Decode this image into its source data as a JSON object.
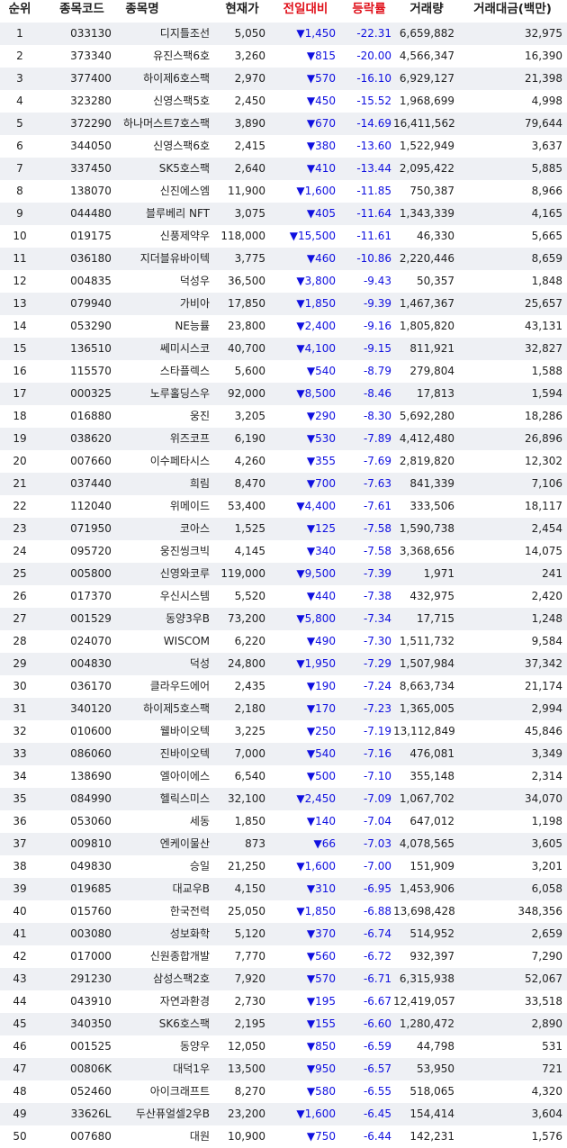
{
  "header": {
    "rank": "순위",
    "code": "종목코드",
    "name": "종목명",
    "price": "현재가",
    "change": "전일대비",
    "rate": "등락률",
    "volume": "거래량",
    "amount": "거래대금(백만)"
  },
  "colors": {
    "down": "#1010e0",
    "header_red": "#e0101a",
    "row_alt": "#eef0f4"
  },
  "rows": [
    {
      "rank": "1",
      "code": "033130",
      "name": "디지틀조선",
      "price": "5,050",
      "change": "▼1,450",
      "rate": "-22.31",
      "volume": "6,659,882",
      "amount": "32,975"
    },
    {
      "rank": "2",
      "code": "373340",
      "name": "유진스팩6호",
      "price": "3,260",
      "change": "▼815",
      "rate": "-20.00",
      "volume": "4,566,347",
      "amount": "16,390"
    },
    {
      "rank": "3",
      "code": "377400",
      "name": "하이제6호스팩",
      "price": "2,970",
      "change": "▼570",
      "rate": "-16.10",
      "volume": "6,929,127",
      "amount": "21,398"
    },
    {
      "rank": "4",
      "code": "323280",
      "name": "신영스팩5호",
      "price": "2,450",
      "change": "▼450",
      "rate": "-15.52",
      "volume": "1,968,699",
      "amount": "4,998"
    },
    {
      "rank": "5",
      "code": "372290",
      "name": "하나머스트7호스팩",
      "price": "3,890",
      "change": "▼670",
      "rate": "-14.69",
      "volume": "16,411,562",
      "amount": "79,644"
    },
    {
      "rank": "6",
      "code": "344050",
      "name": "신영스팩6호",
      "price": "2,415",
      "change": "▼380",
      "rate": "-13.60",
      "volume": "1,522,949",
      "amount": "3,637"
    },
    {
      "rank": "7",
      "code": "337450",
      "name": "SK5호스팩",
      "price": "2,640",
      "change": "▼410",
      "rate": "-13.44",
      "volume": "2,095,422",
      "amount": "5,885"
    },
    {
      "rank": "8",
      "code": "138070",
      "name": "신진에스엠",
      "price": "11,900",
      "change": "▼1,600",
      "rate": "-11.85",
      "volume": "750,387",
      "amount": "8,966"
    },
    {
      "rank": "9",
      "code": "044480",
      "name": "블루베리 NFT",
      "price": "3,075",
      "change": "▼405",
      "rate": "-11.64",
      "volume": "1,343,339",
      "amount": "4,165"
    },
    {
      "rank": "10",
      "code": "019175",
      "name": "신풍제약우",
      "price": "118,000",
      "change": "▼15,500",
      "rate": "-11.61",
      "volume": "46,330",
      "amount": "5,665"
    },
    {
      "rank": "11",
      "code": "036180",
      "name": "지더블유바이텍",
      "price": "3,775",
      "change": "▼460",
      "rate": "-10.86",
      "volume": "2,220,446",
      "amount": "8,659"
    },
    {
      "rank": "12",
      "code": "004835",
      "name": "덕성우",
      "price": "36,500",
      "change": "▼3,800",
      "rate": "-9.43",
      "volume": "50,357",
      "amount": "1,848"
    },
    {
      "rank": "13",
      "code": "079940",
      "name": "가비아",
      "price": "17,850",
      "change": "▼1,850",
      "rate": "-9.39",
      "volume": "1,467,367",
      "amount": "25,657"
    },
    {
      "rank": "14",
      "code": "053290",
      "name": "NE능률",
      "price": "23,800",
      "change": "▼2,400",
      "rate": "-9.16",
      "volume": "1,805,820",
      "amount": "43,131"
    },
    {
      "rank": "15",
      "code": "136510",
      "name": "쎄미시스코",
      "price": "40,700",
      "change": "▼4,100",
      "rate": "-9.15",
      "volume": "811,921",
      "amount": "32,827"
    },
    {
      "rank": "16",
      "code": "115570",
      "name": "스타플렉스",
      "price": "5,600",
      "change": "▼540",
      "rate": "-8.79",
      "volume": "279,804",
      "amount": "1,588"
    },
    {
      "rank": "17",
      "code": "000325",
      "name": "노루홀딩스우",
      "price": "92,000",
      "change": "▼8,500",
      "rate": "-8.46",
      "volume": "17,813",
      "amount": "1,594"
    },
    {
      "rank": "18",
      "code": "016880",
      "name": "웅진",
      "price": "3,205",
      "change": "▼290",
      "rate": "-8.30",
      "volume": "5,692,280",
      "amount": "18,286"
    },
    {
      "rank": "19",
      "code": "038620",
      "name": "위즈코프",
      "price": "6,190",
      "change": "▼530",
      "rate": "-7.89",
      "volume": "4,412,480",
      "amount": "26,896"
    },
    {
      "rank": "20",
      "code": "007660",
      "name": "이수페타시스",
      "price": "4,260",
      "change": "▼355",
      "rate": "-7.69",
      "volume": "2,819,820",
      "amount": "12,302"
    },
    {
      "rank": "21",
      "code": "037440",
      "name": "희림",
      "price": "8,470",
      "change": "▼700",
      "rate": "-7.63",
      "volume": "841,339",
      "amount": "7,106"
    },
    {
      "rank": "22",
      "code": "112040",
      "name": "위메이드",
      "price": "53,400",
      "change": "▼4,400",
      "rate": "-7.61",
      "volume": "333,506",
      "amount": "18,117"
    },
    {
      "rank": "23",
      "code": "071950",
      "name": "코아스",
      "price": "1,525",
      "change": "▼125",
      "rate": "-7.58",
      "volume": "1,590,738",
      "amount": "2,454"
    },
    {
      "rank": "24",
      "code": "095720",
      "name": "웅진씽크빅",
      "price": "4,145",
      "change": "▼340",
      "rate": "-7.58",
      "volume": "3,368,656",
      "amount": "14,075"
    },
    {
      "rank": "25",
      "code": "005800",
      "name": "신영와코루",
      "price": "119,000",
      "change": "▼9,500",
      "rate": "-7.39",
      "volume": "1,971",
      "amount": "241"
    },
    {
      "rank": "26",
      "code": "017370",
      "name": "우신시스템",
      "price": "5,520",
      "change": "▼440",
      "rate": "-7.38",
      "volume": "432,975",
      "amount": "2,420"
    },
    {
      "rank": "27",
      "code": "001529",
      "name": "동양3우B",
      "price": "73,200",
      "change": "▼5,800",
      "rate": "-7.34",
      "volume": "17,715",
      "amount": "1,248"
    },
    {
      "rank": "28",
      "code": "024070",
      "name": "WISCOM",
      "price": "6,220",
      "change": "▼490",
      "rate": "-7.30",
      "volume": "1,511,732",
      "amount": "9,584"
    },
    {
      "rank": "29",
      "code": "004830",
      "name": "덕성",
      "price": "24,800",
      "change": "▼1,950",
      "rate": "-7.29",
      "volume": "1,507,984",
      "amount": "37,342"
    },
    {
      "rank": "30",
      "code": "036170",
      "name": "클라우드에어",
      "price": "2,435",
      "change": "▼190",
      "rate": "-7.24",
      "volume": "8,663,734",
      "amount": "21,174"
    },
    {
      "rank": "31",
      "code": "340120",
      "name": "하이제5호스팩",
      "price": "2,180",
      "change": "▼170",
      "rate": "-7.23",
      "volume": "1,365,005",
      "amount": "2,994"
    },
    {
      "rank": "32",
      "code": "010600",
      "name": "웰바이오텍",
      "price": "3,225",
      "change": "▼250",
      "rate": "-7.19",
      "volume": "13,112,849",
      "amount": "45,846"
    },
    {
      "rank": "33",
      "code": "086060",
      "name": "진바이오텍",
      "price": "7,000",
      "change": "▼540",
      "rate": "-7.16",
      "volume": "476,081",
      "amount": "3,349"
    },
    {
      "rank": "34",
      "code": "138690",
      "name": "엘아이에스",
      "price": "6,540",
      "change": "▼500",
      "rate": "-7.10",
      "volume": "355,148",
      "amount": "2,314"
    },
    {
      "rank": "35",
      "code": "084990",
      "name": "헬릭스미스",
      "price": "32,100",
      "change": "▼2,450",
      "rate": "-7.09",
      "volume": "1,067,702",
      "amount": "34,070"
    },
    {
      "rank": "36",
      "code": "053060",
      "name": "세동",
      "price": "1,850",
      "change": "▼140",
      "rate": "-7.04",
      "volume": "647,012",
      "amount": "1,198"
    },
    {
      "rank": "37",
      "code": "009810",
      "name": "엔케이물산",
      "price": "873",
      "change": "▼66",
      "rate": "-7.03",
      "volume": "4,078,565",
      "amount": "3,605"
    },
    {
      "rank": "38",
      "code": "049830",
      "name": "승일",
      "price": "21,250",
      "change": "▼1,600",
      "rate": "-7.00",
      "volume": "151,909",
      "amount": "3,201"
    },
    {
      "rank": "39",
      "code": "019685",
      "name": "대교우B",
      "price": "4,150",
      "change": "▼310",
      "rate": "-6.95",
      "volume": "1,453,906",
      "amount": "6,058"
    },
    {
      "rank": "40",
      "code": "015760",
      "name": "한국전력",
      "price": "25,050",
      "change": "▼1,850",
      "rate": "-6.88",
      "volume": "13,698,428",
      "amount": "348,356"
    },
    {
      "rank": "41",
      "code": "003080",
      "name": "성보화학",
      "price": "5,120",
      "change": "▼370",
      "rate": "-6.74",
      "volume": "514,952",
      "amount": "2,659"
    },
    {
      "rank": "42",
      "code": "017000",
      "name": "신원종합개발",
      "price": "7,770",
      "change": "▼560",
      "rate": "-6.72",
      "volume": "932,397",
      "amount": "7,290"
    },
    {
      "rank": "43",
      "code": "291230",
      "name": "삼성스팩2호",
      "price": "7,920",
      "change": "▼570",
      "rate": "-6.71",
      "volume": "6,315,938",
      "amount": "52,067"
    },
    {
      "rank": "44",
      "code": "043910",
      "name": "자연과환경",
      "price": "2,730",
      "change": "▼195",
      "rate": "-6.67",
      "volume": "12,419,057",
      "amount": "33,518"
    },
    {
      "rank": "45",
      "code": "340350",
      "name": "SK6호스팩",
      "price": "2,195",
      "change": "▼155",
      "rate": "-6.60",
      "volume": "1,280,472",
      "amount": "2,890"
    },
    {
      "rank": "46",
      "code": "001525",
      "name": "동양우",
      "price": "12,050",
      "change": "▼850",
      "rate": "-6.59",
      "volume": "44,798",
      "amount": "531"
    },
    {
      "rank": "47",
      "code": "00806K",
      "name": "대덕1우",
      "price": "13,500",
      "change": "▼950",
      "rate": "-6.57",
      "volume": "53,950",
      "amount": "721"
    },
    {
      "rank": "48",
      "code": "052460",
      "name": "아이크래프트",
      "price": "8,270",
      "change": "▼580",
      "rate": "-6.55",
      "volume": "518,065",
      "amount": "4,320"
    },
    {
      "rank": "49",
      "code": "33626L",
      "name": "두산퓨얼셀2우B",
      "price": "23,200",
      "change": "▼1,600",
      "rate": "-6.45",
      "volume": "154,414",
      "amount": "3,604"
    },
    {
      "rank": "50",
      "code": "007680",
      "name": "대원",
      "price": "10,900",
      "change": "▼750",
      "rate": "-6.44",
      "volume": "142,231",
      "amount": "1,576"
    }
  ]
}
